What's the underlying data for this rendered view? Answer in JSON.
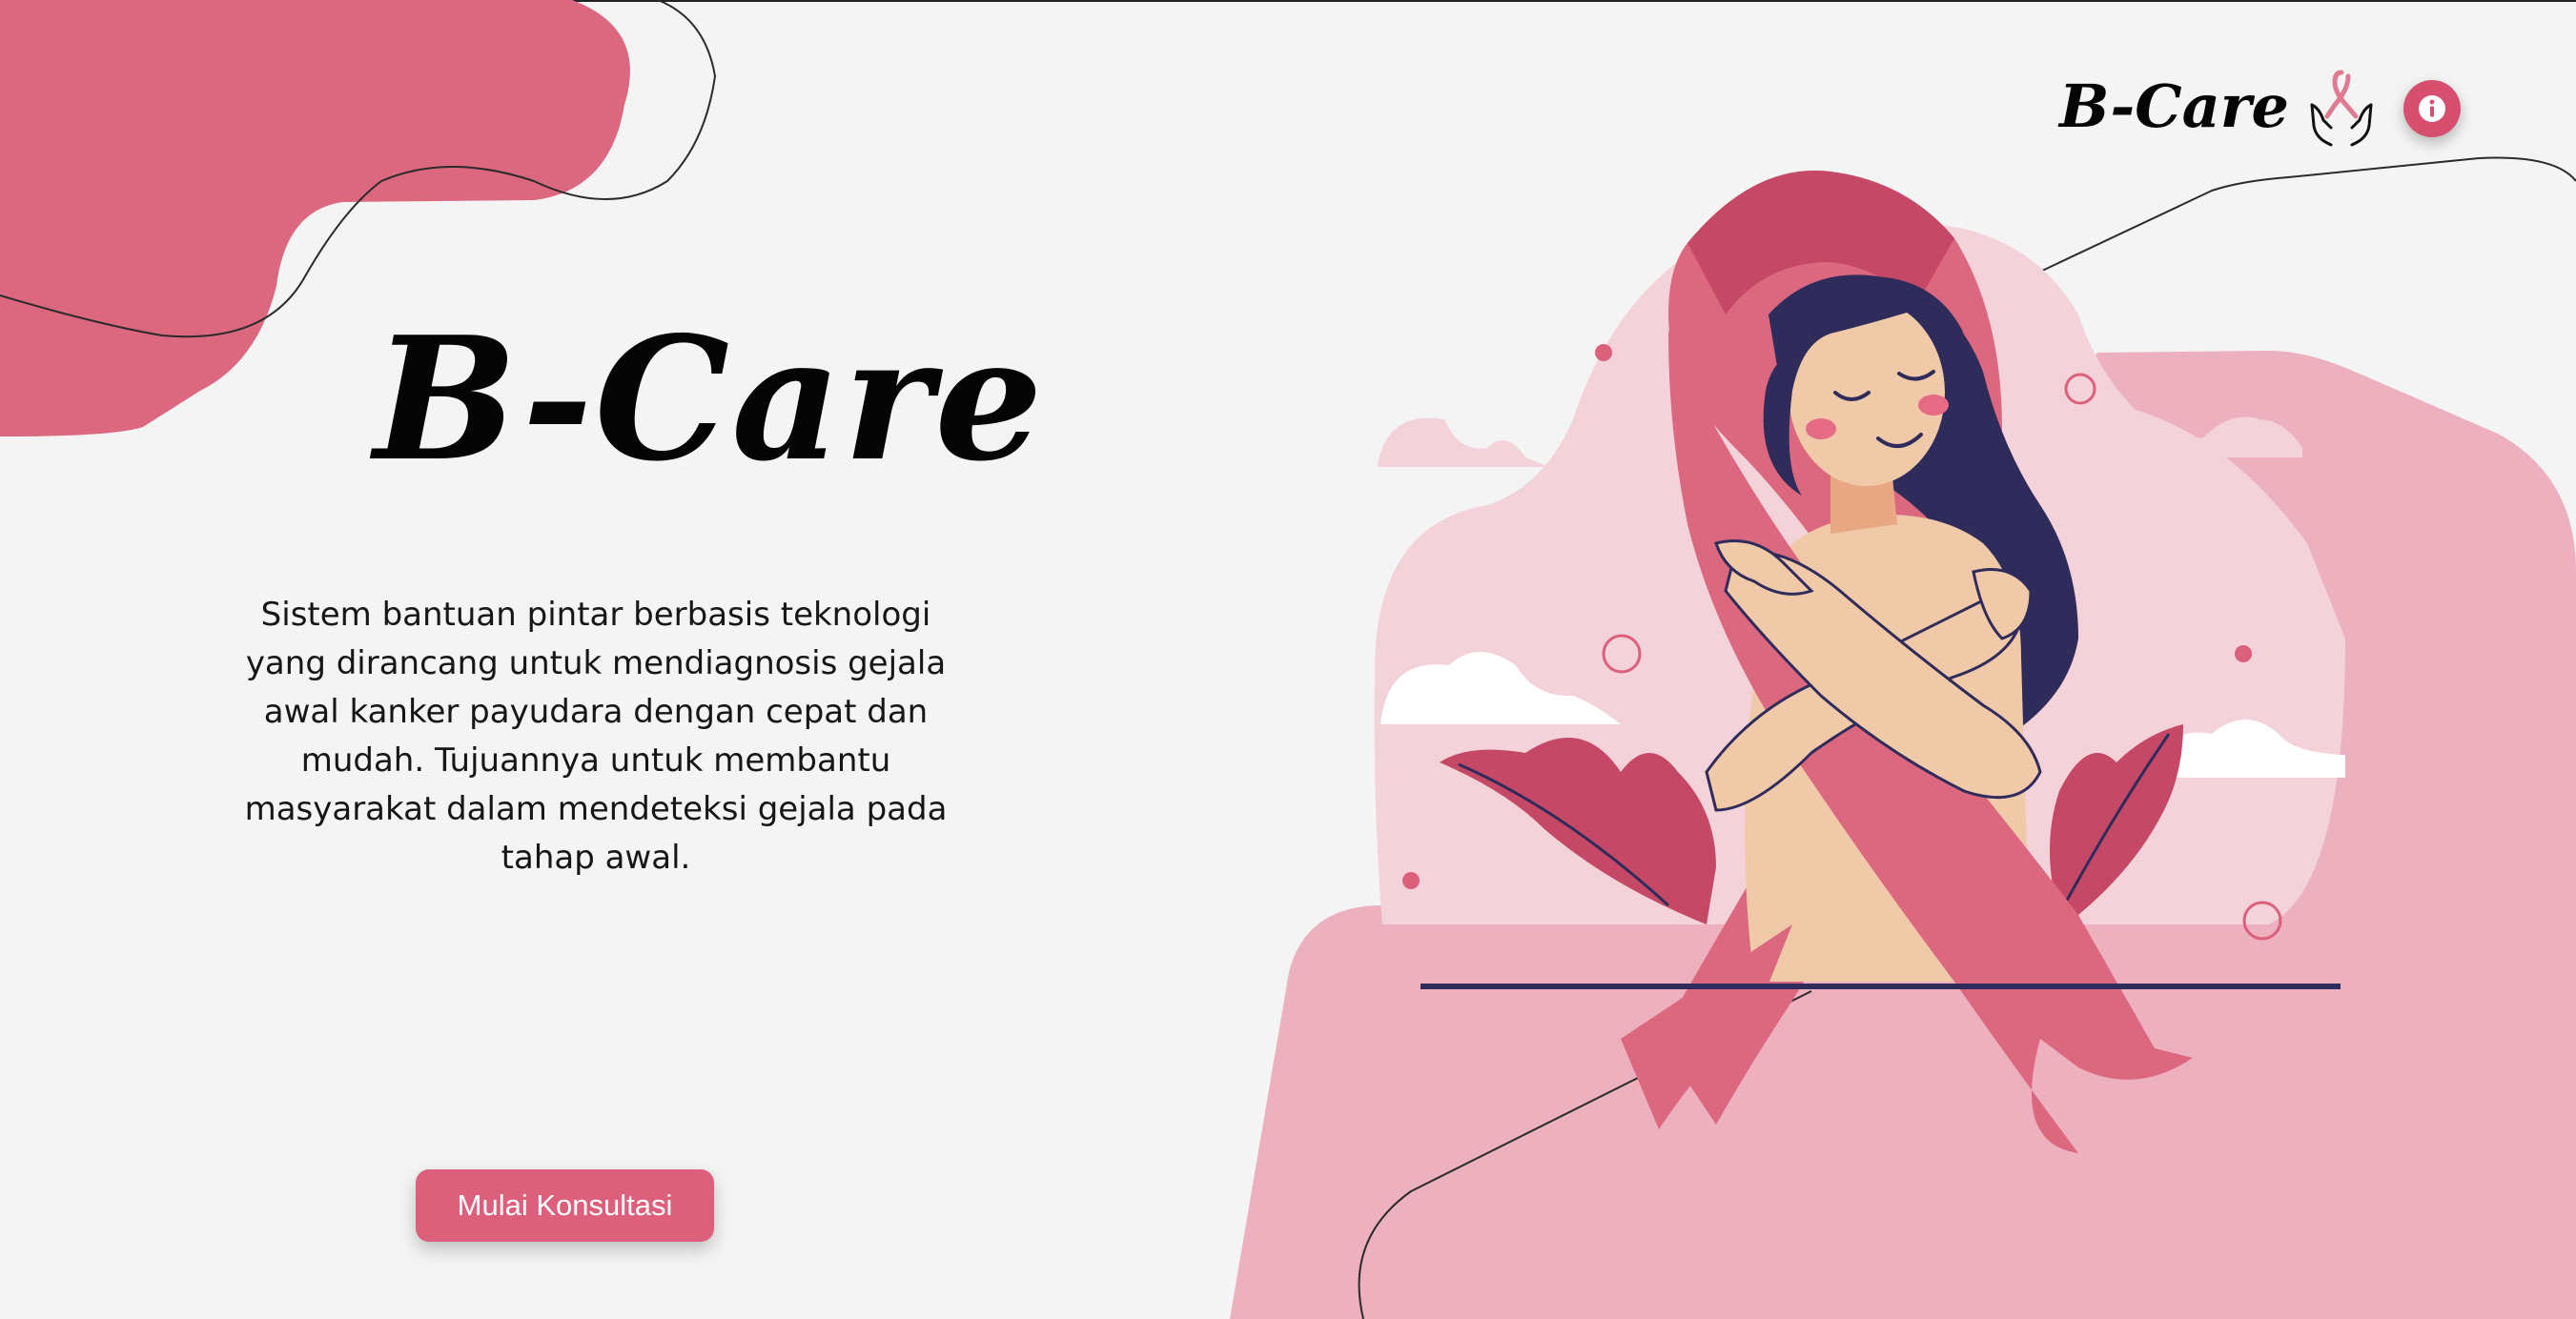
{
  "hero": {
    "title": "B-Care",
    "description": "Sistem bantuan pintar berbasis teknologi yang dirancang untuk mendiagnosis gejala awal kanker payudara dengan cepat dan mudah. Tujuannya untuk membantu masyarakat dalam mendeteksi gejala pada tahap awal.",
    "cta_label": "Mulai Konsultasi"
  },
  "header": {
    "logo_text": "B-Care",
    "logo_icon": "ribbon-hands-icon",
    "info_icon": "info-icon"
  },
  "illustration": {
    "subject": "woman-hugging-pink-ribbon-illustration"
  },
  "colors": {
    "background": "#f4f4f4",
    "primary_pink": "#dc5f7b",
    "light_pink": "#ecb0bf",
    "pale_pink": "#f3d2da",
    "dark_pink": "#c54866",
    "hair_navy": "#2f2b5b",
    "skin": "#f0c9a8",
    "text_dark": "#050505"
  }
}
